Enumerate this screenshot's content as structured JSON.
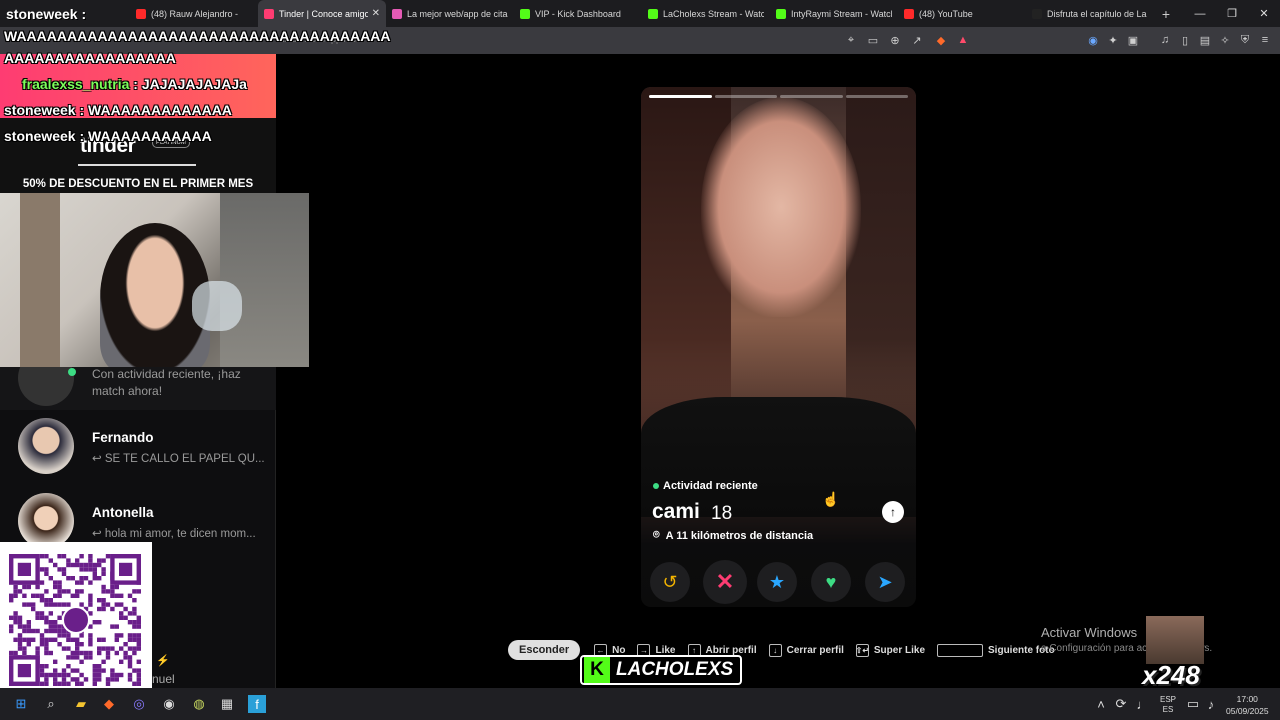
{
  "browser": {
    "tabs": [
      {
        "label": "(48) Rauw Alejandro -",
        "color": "#ff2a2a",
        "active": false
      },
      {
        "label": "Tinder | Conoce amigos",
        "color": "#fe3c72",
        "active": true
      },
      {
        "label": "La mejor web/app de citas",
        "color": "#e55ab5",
        "active": false
      },
      {
        "label": "VIP - Kick Dashboard",
        "color": "#53fc18",
        "active": false
      },
      {
        "label": "LaCholexs Stream - Watch",
        "color": "#53fc18",
        "active": false
      },
      {
        "label": "IntyRaymi Stream - Watch",
        "color": "#53fc18",
        "active": false
      },
      {
        "label": "(48) YouTube",
        "color": "#ff2a2a",
        "active": false
      },
      {
        "label": "Disfruta el capítulo de La",
        "color": "#222222",
        "active": false
      }
    ],
    "new_tab": "+",
    "url": "tinder.com/app/recs"
  },
  "chat": {
    "top_user": "stoneweek :",
    "lines": [
      {
        "user": "",
        "text": "WAAAAAAAAAAAAAAAAAAAAAAAAAAAAAAAAAAAAA"
      },
      {
        "user": "",
        "text": "AAAAAAAAAAAAAAAAA"
      },
      {
        "user": "fraalexss_nutria",
        "text": " : JAJAJAJAJAJa"
      },
      {
        "user": "stoneweek",
        "text": " : WAAAAAAAAAAAAA"
      },
      {
        "user": "stoneweek",
        "text": " : WAAAAAAAAAAA"
      }
    ]
  },
  "sidebar": {
    "brand": "tinder",
    "badge": "PLATINUM",
    "promo": "50% DE DESCUENTO EN EL PRIMER MES",
    "recent": {
      "msg": "Con actividad reciente, ¡haz match ahora!"
    },
    "matches": [
      {
        "name": "Fernando",
        "msg": "↩ SE TE CALLO EL PAPEL QU..."
      },
      {
        "name": "Antonella",
        "msg": "↩ hola mi amor, te dicen mom..."
      }
    ],
    "partial_name": "nuel"
  },
  "profile": {
    "activity": "Actividad reciente",
    "name": "cami",
    "age": "18",
    "distance": "A 11 kilómetros de distancia",
    "photo_count": 4,
    "current_photo": 1
  },
  "hints": {
    "hide": "Esconder",
    "items": [
      {
        "key": "←",
        "label": "No"
      },
      {
        "key": "→",
        "label": "Like"
      },
      {
        "key": "↑",
        "label": "Abrir perfil"
      },
      {
        "key": "↓",
        "label": "Cerrar perfil"
      },
      {
        "key": "⇧↵",
        "label": "Super Like"
      },
      {
        "key": "",
        "label": "Siguiente foto",
        "wide": true
      }
    ]
  },
  "overlay": {
    "kick_brand": "LACHOLEXS",
    "activate_title": "Activar Windows",
    "activate_sub": "a Configuración para activar Windows.",
    "multiplier": "x248"
  },
  "taskbar": {
    "lang_top": "ESP",
    "lang_bottom": "ES",
    "time": "17:00",
    "date": "05/09/2025"
  },
  "colors": {
    "tinder_pink": "#fe3c72",
    "kick_green": "#53fc18",
    "online_green": "#3ddc84"
  }
}
